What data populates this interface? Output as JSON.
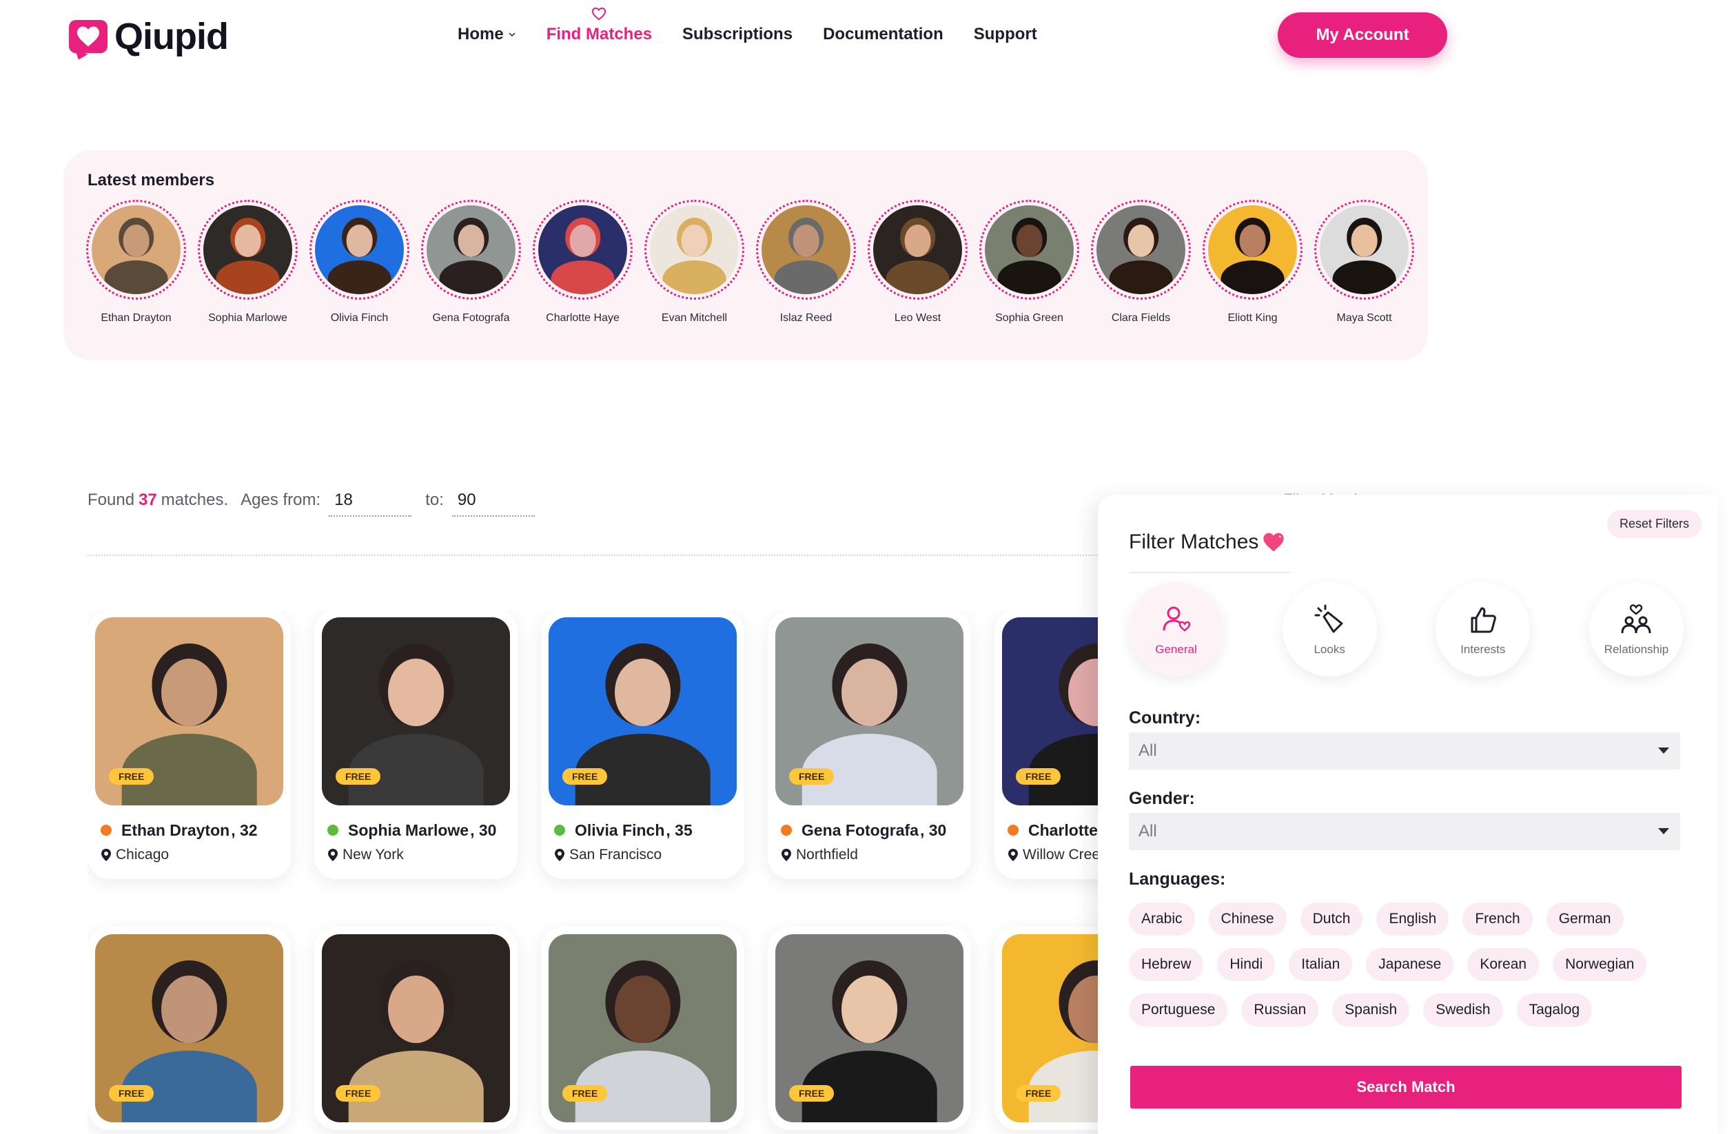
{
  "brand": {
    "name": "Qiupid",
    "accent": "#e8217f"
  },
  "nav": {
    "items": [
      {
        "label": "Home",
        "has_dropdown": true,
        "active": false
      },
      {
        "label": "Find Matches",
        "has_dropdown": false,
        "active": true
      },
      {
        "label": "Subscriptions",
        "has_dropdown": false,
        "active": false
      },
      {
        "label": "Documentation",
        "has_dropdown": false,
        "active": false
      },
      {
        "label": "Support",
        "has_dropdown": false,
        "active": false
      }
    ],
    "account_label": "My Account"
  },
  "latest": {
    "title": "Latest members",
    "members": [
      {
        "name": "Ethan Drayton",
        "bg": "#d9a878",
        "skin": "#c99a78",
        "hair": "#5a4a3a"
      },
      {
        "name": "Sophia Marlowe",
        "bg": "#2e2a28",
        "skin": "#e5b9a0",
        "hair": "#a8431f"
      },
      {
        "name": "Olivia Finch",
        "bg": "#1f6fe0",
        "skin": "#e0b8a0",
        "hair": "#3a2418"
      },
      {
        "name": "Gena Fotografa",
        "bg": "#8f9694",
        "skin": "#d9b4a0",
        "hair": "#2a2020"
      },
      {
        "name": "Charlotte Haye",
        "bg": "#2a2f6a",
        "skin": "#e0a8a8",
        "hair": "#d84848"
      },
      {
        "name": "Evan Mitchell",
        "bg": "#ede6dc",
        "skin": "#f0d0b8",
        "hair": "#d8b060"
      },
      {
        "name": "Islaz Reed",
        "bg": "#b88a4a",
        "skin": "#c09478",
        "hair": "#6a6a6a"
      },
      {
        "name": "Leo West",
        "bg": "#2c2420",
        "skin": "#d8a888",
        "hair": "#6a4a2a"
      },
      {
        "name": "Sophia Green",
        "bg": "#7a8070",
        "skin": "#6a4430",
        "hair": "#1a1410"
      },
      {
        "name": "Clara Fields",
        "bg": "#7a7a78",
        "skin": "#e8c4a8",
        "hair": "#2a1a12"
      },
      {
        "name": "Eliott King",
        "bg": "#f4b830",
        "skin": "#b88060",
        "hair": "#1a1210"
      },
      {
        "name": "Maya Scott",
        "bg": "#dcdcdc",
        "skin": "#e8c0a0",
        "hair": "#1a1410"
      }
    ]
  },
  "found": {
    "prefix": "Found",
    "count": "37",
    "suffix": "matches.",
    "ages_from_label": "Ages from:",
    "age_from": "18",
    "to_label": "to:",
    "age_to": "90"
  },
  "cards": [
    {
      "name": "Ethan Drayton",
      "age": "32",
      "city": "Chicago",
      "badge": "FREE",
      "status_color": "#f47a1f",
      "bg": "#d9a878",
      "skin": "#c99a78",
      "body": "#6a6a4a"
    },
    {
      "name": "Sophia Marlowe",
      "age": "30",
      "city": "New York",
      "badge": "FREE",
      "status_color": "#5cba3c",
      "bg": "#2e2a28",
      "skin": "#e5b9a0",
      "body": "#3a3a3a"
    },
    {
      "name": "Olivia Finch",
      "age": "35",
      "city": "San Francisco",
      "badge": "FREE",
      "status_color": "#5cba3c",
      "bg": "#1f6fe0",
      "skin": "#e0b8a0",
      "body": "#2a2a2a"
    },
    {
      "name": "Gena Fotografa",
      "age": "30",
      "city": "Northfield",
      "badge": "FREE",
      "status_color": "#f47a1f",
      "bg": "#8f9694",
      "skin": "#d9b4a0",
      "body": "#d8dce8"
    },
    {
      "name": "Charlotte Haye",
      "age": "",
      "city": "Willow Creek",
      "badge": "FREE",
      "status_color": "#f47a1f",
      "bg": "#2a2f6a",
      "skin": "#e0a8a8",
      "body": "#1a1a1a"
    },
    {
      "name": "",
      "age": "",
      "city": "",
      "badge": "FREE",
      "status_color": "#f47a1f",
      "bg": "#b88a4a",
      "skin": "#c09478",
      "body": "#3a6a9a"
    },
    {
      "name": "",
      "age": "",
      "city": "",
      "badge": "FREE",
      "status_color": "#f47a1f",
      "bg": "#2c2420",
      "skin": "#d8a888",
      "body": "#c8a878"
    },
    {
      "name": "",
      "age": "",
      "city": "",
      "badge": "FREE",
      "status_color": "#f47a1f",
      "bg": "#7a8070",
      "skin": "#6a4430",
      "body": "#d0d4d8"
    },
    {
      "name": "",
      "age": "",
      "city": "",
      "badge": "FREE",
      "status_color": "#f47a1f",
      "bg": "#7a7a78",
      "skin": "#e8c4a8",
      "body": "#1a1a1a"
    },
    {
      "name": "",
      "age": "",
      "city": "",
      "badge": "FREE",
      "status_color": "#f47a1f",
      "bg": "#f4b830",
      "skin": "#b88060",
      "body": "#e8e4de"
    }
  ],
  "filter": {
    "ghost_label": "Filter Matches",
    "title": "Filter Matches",
    "reset_label": "Reset Filters",
    "tabs": [
      {
        "label": "General",
        "icon": "person-heart-icon",
        "active": true
      },
      {
        "label": "Looks",
        "icon": "sparkle-hand-icon",
        "active": false
      },
      {
        "label": "Interests",
        "icon": "thumbs-up-icon",
        "active": false
      },
      {
        "label": "Relationship",
        "icon": "couple-heart-icon",
        "active": false
      }
    ],
    "country_label": "Country:",
    "country_value": "All",
    "gender_label": "Gender:",
    "gender_value": "All",
    "languages_label": "Languages:",
    "languages": [
      "Arabic",
      "Chinese",
      "Dutch",
      "English",
      "French",
      "German",
      "Hebrew",
      "Hindi",
      "Italian",
      "Japanese",
      "Korean",
      "Norwegian",
      "Portuguese",
      "Russian",
      "Spanish",
      "Swedish",
      "Tagalog"
    ],
    "search_label": "Search Match"
  }
}
